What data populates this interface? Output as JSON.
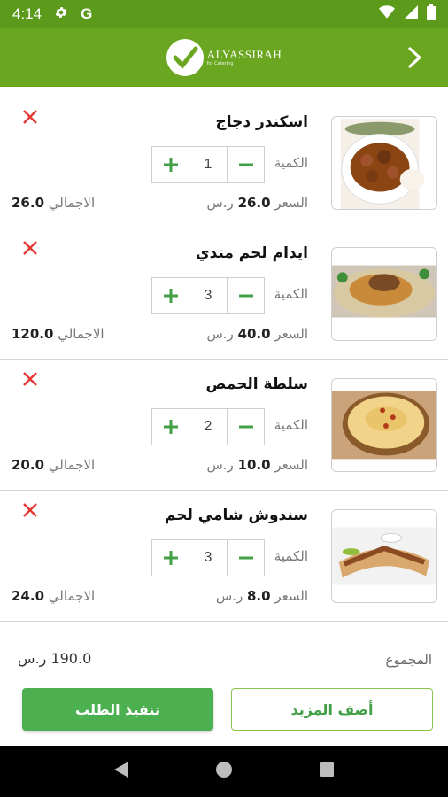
{
  "status_bar": {
    "time": "4:14",
    "g_label": "G",
    "icons": [
      "gear-icon",
      "wifi-icon",
      "signal-icon",
      "battery-icon"
    ]
  },
  "app_bar": {
    "brand": "ALYASSIRAH",
    "brand_sub": "for Catering",
    "accent": "#6aa61f"
  },
  "labels": {
    "qty": "الكمية",
    "price": "السعر",
    "total": "الاجمالي",
    "currency": "ر.س"
  },
  "items": [
    {
      "name": "اسكندر دجاج",
      "qty": "1",
      "price": "26.0",
      "total": "26.0"
    },
    {
      "name": "ايدام لحم مندي",
      "qty": "3",
      "price": "40.0",
      "total": "120.0"
    },
    {
      "name": "سلطة الحمص",
      "qty": "2",
      "price": "10.0",
      "total": "20.0"
    },
    {
      "name": "سندوش شامي لحم",
      "qty": "3",
      "price": "8.0",
      "total": "24.0"
    }
  ],
  "summary": {
    "label": "المجموع",
    "value": "190.0 ر.س"
  },
  "buttons": {
    "checkout": "تنفيذ الطلب",
    "add_more": "أضف المزيد"
  },
  "colors": {
    "primary_green": "#4caf50",
    "remove_red": "#e53935"
  }
}
